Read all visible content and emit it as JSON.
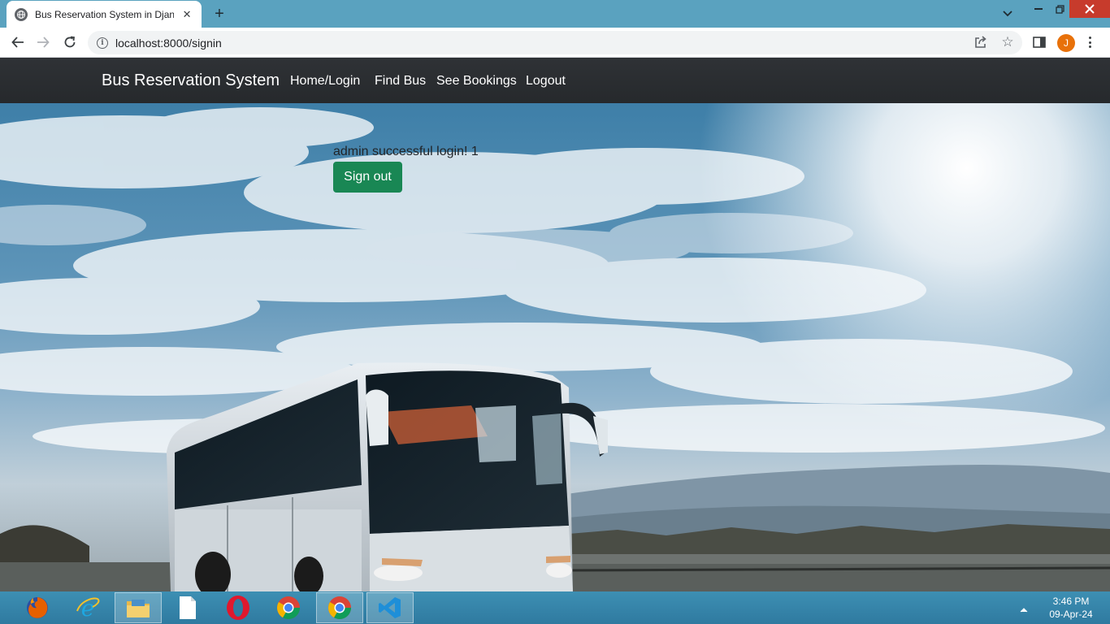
{
  "browser": {
    "tab": {
      "title": "Bus Reservation System in Djang",
      "favicon": "globe-icon",
      "close_icon": "close-icon"
    },
    "new_tab_icon": "plus-icon",
    "url": "localhost:8000/signin",
    "profile_initial": "J",
    "window_controls": [
      "minimize-icon",
      "restore-icon",
      "close-icon"
    ]
  },
  "navbar": {
    "brand": "Bus Reservation System",
    "links": [
      "Home/Login",
      "Find Bus",
      "See Bookings",
      "Logout"
    ]
  },
  "content": {
    "message": "admin successful login! 1",
    "signout_label": "Sign out",
    "signout_color": "#198754"
  },
  "taskbar": {
    "apps": [
      "firefox-icon",
      "internet-explorer-icon",
      "file-explorer-icon",
      "notepad-icon",
      "opera-icon",
      "chrome-icon",
      "chrome-icon",
      "vscode-icon"
    ],
    "time": "3:46 PM",
    "date": "09-Apr-24"
  }
}
